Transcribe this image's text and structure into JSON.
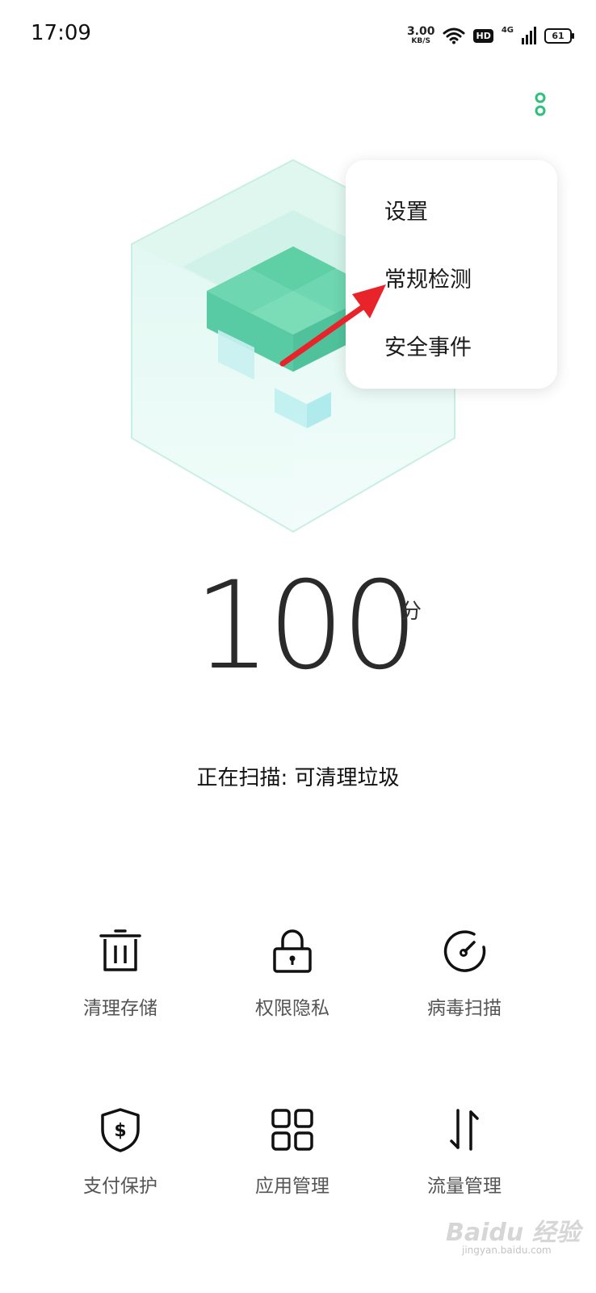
{
  "status_bar": {
    "time": "17:09",
    "net_speed_value": "3.00",
    "net_speed_unit": "KB/S",
    "hd_badge": "HD",
    "network_type": "4G",
    "battery_level": "61"
  },
  "menu": {
    "items": [
      {
        "label": "设置"
      },
      {
        "label": "常规检测"
      },
      {
        "label": "安全事件"
      }
    ]
  },
  "score": {
    "value": "100",
    "unit": "分"
  },
  "scan_status": "正在扫描: 可清理垃圾",
  "features": [
    {
      "label": "清理存储",
      "icon": "trash-icon"
    },
    {
      "label": "权限隐私",
      "icon": "lock-icon"
    },
    {
      "label": "病毒扫描",
      "icon": "gauge-icon"
    },
    {
      "label": "支付保护",
      "icon": "shield-dollar-icon"
    },
    {
      "label": "应用管理",
      "icon": "grid-icon"
    },
    {
      "label": "流量管理",
      "icon": "arrows-updown-icon"
    }
  ],
  "watermark": {
    "brand": "Baidu 经验",
    "url": "jingyan.baidu.com"
  },
  "colors": {
    "accent": "#2ec07a",
    "annotation_arrow": "#e8232a"
  }
}
